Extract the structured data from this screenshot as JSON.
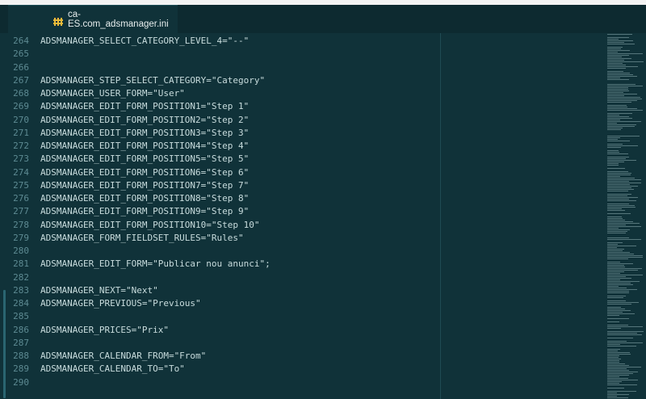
{
  "window": {
    "tab_title": "ca-ES.com_adsmanager.ini"
  },
  "editor": {
    "lines": [
      {
        "no": "264",
        "text": "ADSMANAGER_SELECT_CATEGORY_LEVEL_4=\"--\""
      },
      {
        "no": "265",
        "text": ""
      },
      {
        "no": "266",
        "text": ""
      },
      {
        "no": "267",
        "text": "ADSMANAGER_STEP_SELECT_CATEGORY=\"Category\""
      },
      {
        "no": "268",
        "text": "ADSMANAGER_USER_FORM=\"User\""
      },
      {
        "no": "269",
        "text": "ADSMANAGER_EDIT_FORM_POSITION1=\"Step 1\""
      },
      {
        "no": "270",
        "text": "ADSMANAGER_EDIT_FORM_POSITION2=\"Step 2\""
      },
      {
        "no": "271",
        "text": "ADSMANAGER_EDIT_FORM_POSITION3=\"Step 3\""
      },
      {
        "no": "272",
        "text": "ADSMANAGER_EDIT_FORM_POSITION4=\"Step 4\""
      },
      {
        "no": "273",
        "text": "ADSMANAGER_EDIT_FORM_POSITION5=\"Step 5\""
      },
      {
        "no": "274",
        "text": "ADSMANAGER_EDIT_FORM_POSITION6=\"Step 6\""
      },
      {
        "no": "275",
        "text": "ADSMANAGER_EDIT_FORM_POSITION7=\"Step 7\""
      },
      {
        "no": "276",
        "text": "ADSMANAGER_EDIT_FORM_POSITION8=\"Step 8\""
      },
      {
        "no": "277",
        "text": "ADSMANAGER_EDIT_FORM_POSITION9=\"Step 9\""
      },
      {
        "no": "278",
        "text": "ADSMANAGER_EDIT_FORM_POSITION10=\"Step 10\""
      },
      {
        "no": "279",
        "text": "ADSMANAGER_FORM_FIELDSET_RULES=\"Rules\""
      },
      {
        "no": "280",
        "text": ""
      },
      {
        "no": "281",
        "text": "ADSMANAGER_EDIT_FORM=\"Publicar nou anunci\";"
      },
      {
        "no": "282",
        "text": ""
      },
      {
        "no": "283",
        "text": "ADSMANAGER_NEXT=\"Next\""
      },
      {
        "no": "284",
        "text": "ADSMANAGER_PREVIOUS=\"Previous\""
      },
      {
        "no": "285",
        "text": ""
      },
      {
        "no": "286",
        "text": "ADSMANAGER_PRICES=\"Prix\""
      },
      {
        "no": "287",
        "text": ""
      },
      {
        "no": "288",
        "text": "ADSMANAGER_CALENDAR_FROM=\"From\""
      },
      {
        "no": "289",
        "text": "ADSMANAGER_CALENDAR_TO=\"To\""
      },
      {
        "no": "290",
        "text": ""
      }
    ]
  },
  "icons": {
    "tab_icon": "ini-file-icon"
  },
  "colors": {
    "background": "#103239",
    "tab_icon": "#e7b93a",
    "line_numbers": "#5d8a92",
    "text": "#c8dcdd"
  }
}
